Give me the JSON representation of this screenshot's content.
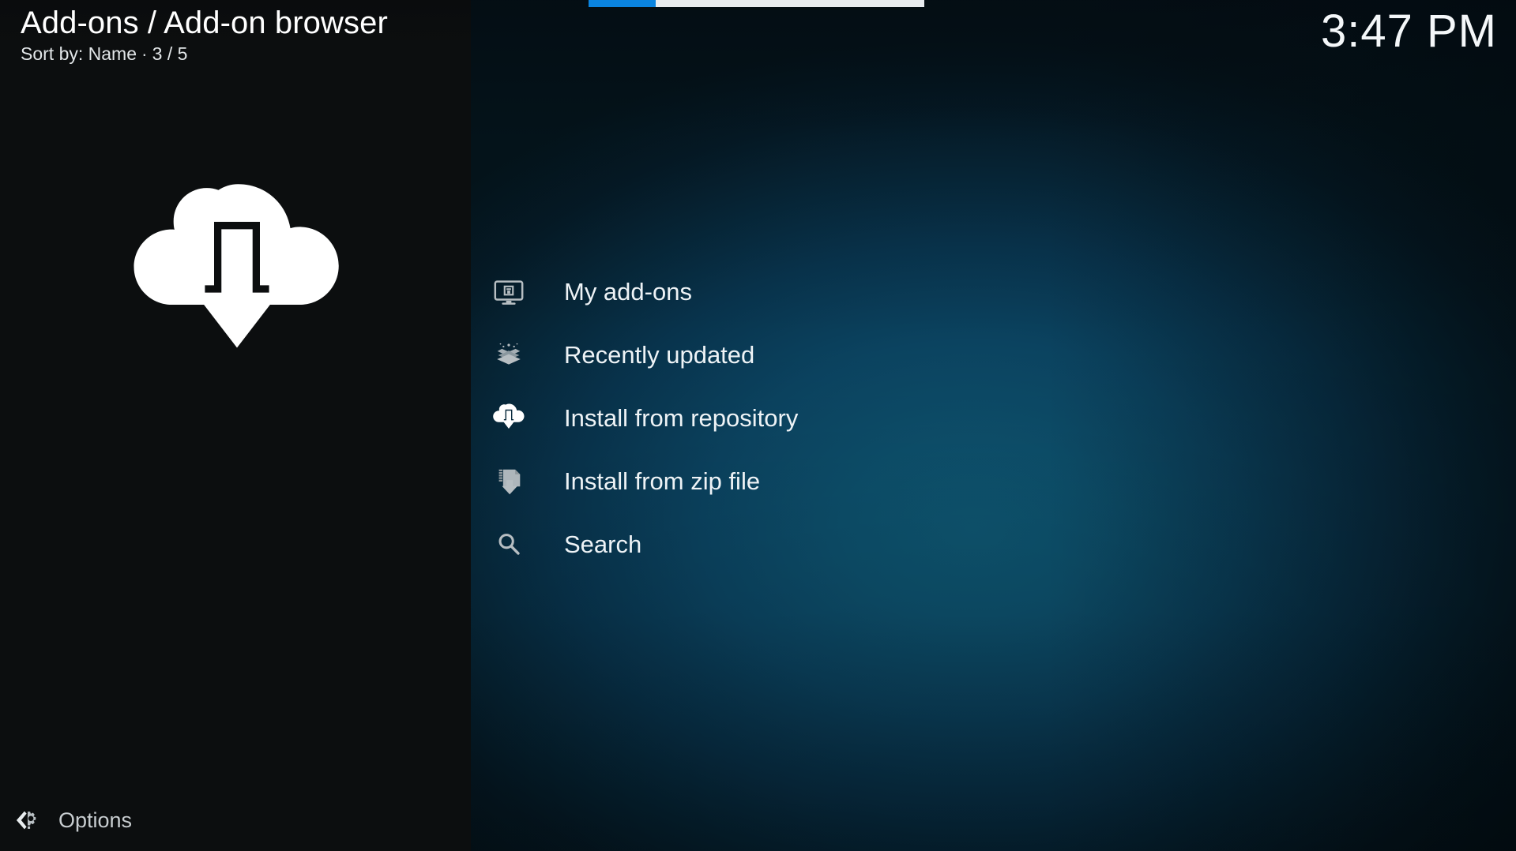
{
  "window": {
    "app": "Kodi",
    "screen_name": "add-on-browser"
  },
  "header": {
    "title": "Add-ons / Add-on browser",
    "sort_label": "Sort by: Name",
    "separator": "·",
    "position": "3 / 5"
  },
  "clock": {
    "time": "3:47 PM"
  },
  "progress": {
    "percent": 20,
    "fill_color": "#0a84e0",
    "track_color": "#e8ecef"
  },
  "sidebar": {
    "icon": "cloud-download-icon",
    "background_color": "#0c0e0f",
    "options": {
      "label": "Options",
      "icon": "options-gear-icon"
    }
  },
  "main": {
    "background_accent": "#0d4f6b",
    "items": [
      {
        "label": "My add-ons",
        "icon": "monitor-addons-icon",
        "selected": false
      },
      {
        "label": "Recently updated",
        "icon": "open-box-icon",
        "selected": false
      },
      {
        "label": "Install from repository",
        "icon": "cloud-download-icon",
        "selected": true
      },
      {
        "label": "Install from zip file",
        "icon": "zip-file-download-icon",
        "selected": false
      },
      {
        "label": "Search",
        "icon": "magnifier-icon",
        "selected": false
      }
    ]
  }
}
